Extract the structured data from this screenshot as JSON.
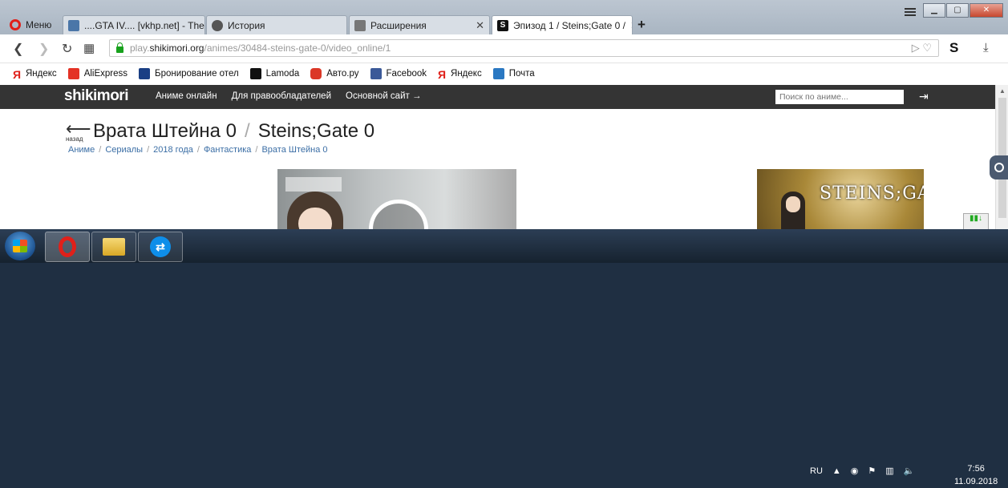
{
  "browser": {
    "menu_label": "Меню",
    "tabs": [
      {
        "label": "....GTA IV.... [vkhp.net] - The",
        "icon": "vk-icon",
        "active": false
      },
      {
        "label": "История",
        "icon": "clock-icon",
        "active": false
      },
      {
        "label": "Расширения",
        "icon": "cube-icon",
        "active": false
      },
      {
        "label": "Эпизод 1 / Steins;Gate 0 /",
        "icon": "shikimori-icon",
        "active": true
      }
    ],
    "new_tab": "+",
    "url": {
      "prefix": "play.",
      "host": "shikimori.org",
      "path": "/animes/30484-steins-gate-0/video_online/1"
    },
    "bookmarks": [
      {
        "label": "Яндекс",
        "icon": "yandex-icon",
        "color": "#e0201a"
      },
      {
        "label": "AliExpress",
        "icon": "aliexpress-icon",
        "color": "#e43225"
      },
      {
        "label": "Бронирование отел",
        "icon": "booking-icon",
        "color": "#1a3f84"
      },
      {
        "label": "Lamoda",
        "icon": "lamoda-icon",
        "color": "#111111"
      },
      {
        "label": "Авто.ру",
        "icon": "autoru-icon",
        "color": "#db3727"
      },
      {
        "label": "Facebook",
        "icon": "facebook-icon",
        "color": "#3b5998"
      },
      {
        "label": "Яндекс",
        "icon": "yandex-icon",
        "color": "#e0201a"
      },
      {
        "label": "Почта",
        "icon": "mail-icon",
        "color": "#2a78c2"
      }
    ]
  },
  "site": {
    "logo": "shikimori",
    "nav": [
      "Аниме онлайн",
      "Для правообладателей",
      "Основной сайт →"
    ],
    "search_placeholder": "Поиск по аниме...",
    "back_label": "назад",
    "title_ru": "Врата Штейна 0",
    "title_sep": "/",
    "title_en": "Steins;Gate 0",
    "breadcrumbs": [
      "Аниме",
      "Сериалы",
      "2018 года",
      "Фантастика",
      "Врата Штейна 0"
    ],
    "poster_text": "STEINS;GATE"
  },
  "taskbar": {
    "lang": "RU",
    "time": "7:56",
    "date": "11.09.2018"
  }
}
